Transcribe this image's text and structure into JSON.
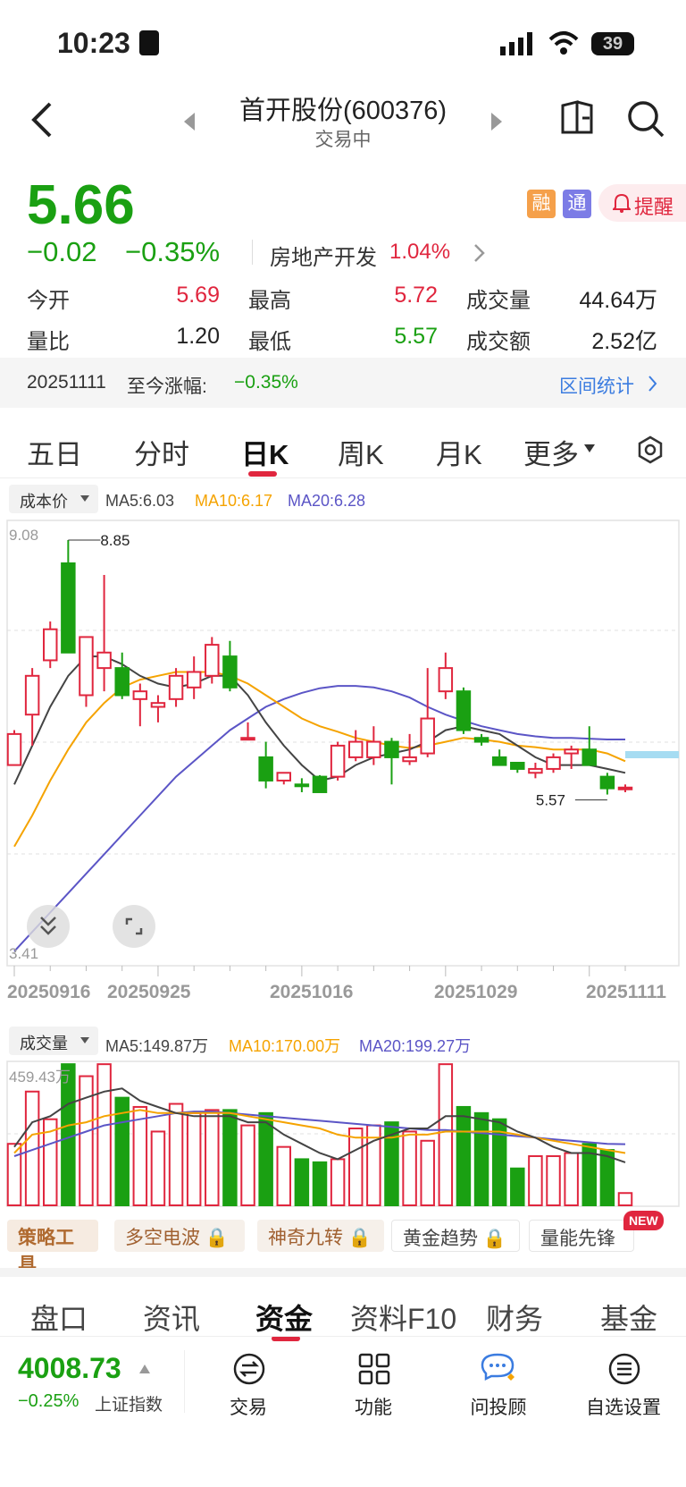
{
  "status": {
    "time": "10:23",
    "battery": "39"
  },
  "header": {
    "title": "首开股份(600376)",
    "subtitle": "交易中"
  },
  "quote": {
    "price": "5.66",
    "change": "−0.02",
    "change_pct": "−0.35%",
    "sector_name": "房地产开发",
    "sector_pct": "1.04%",
    "badge_rong": "融",
    "badge_tong": "通",
    "alert_label": "提醒",
    "stats": [
      {
        "label": "今开",
        "value": "5.69"
      },
      {
        "label": "最高",
        "value": "5.72"
      },
      {
        "label": "成交量",
        "value": "44.64万"
      },
      {
        "label": "量比",
        "value": "1.20"
      },
      {
        "label": "最低",
        "value": "5.57"
      },
      {
        "label": "成交额",
        "value": "2.52亿"
      }
    ]
  },
  "range_bar": {
    "date": "20251111",
    "label": "至今涨幅:",
    "value": "−0.35%",
    "link": "区间统计"
  },
  "chart_tabs": [
    "五日",
    "分时",
    "日K",
    "周K",
    "月K",
    "更多"
  ],
  "kline_legend": {
    "cost": "成本价",
    "ma5": "MA5:6.03",
    "ma10": "MA10:6.17",
    "ma20": "MA20:6.28"
  },
  "volume_legend": {
    "label": "成交量",
    "ma5": "MA5:149.87万",
    "ma10": "MA10:170.00万",
    "ma20": "MA20:199.27万",
    "max": "459.43万"
  },
  "colors": {
    "up": "#e0263e",
    "down": "#1aa012",
    "ma5": "#444444",
    "ma10": "#f5a300",
    "ma20": "#5b55c6"
  },
  "chart_data": {
    "type": "candlestick",
    "ylim": [
      3.41,
      9.08
    ],
    "y_top_label": "9.08",
    "y_bottom_label": "3.41",
    "high_label": "8.85",
    "low_label": "5.57",
    "x_ticks": [
      "20250916",
      "20250925",
      "20251016",
      "20251029",
      "20251111"
    ],
    "candles": [
      {
        "o": 5.95,
        "c": 6.35,
        "h": 6.4,
        "l": 5.95
      },
      {
        "o": 6.6,
        "c": 7.1,
        "h": 7.2,
        "l": 6.2
      },
      {
        "o": 7.3,
        "c": 7.7,
        "h": 7.8,
        "l": 7.2
      },
      {
        "o": 8.55,
        "c": 7.4,
        "h": 8.85,
        "l": 7.4
      },
      {
        "o": 6.85,
        "c": 7.6,
        "h": 7.6,
        "l": 6.7
      },
      {
        "o": 7.2,
        "c": 7.4,
        "h": 8.4,
        "l": 6.9
      },
      {
        "o": 7.2,
        "c": 6.85,
        "h": 7.4,
        "l": 6.8
      },
      {
        "o": 6.8,
        "c": 6.9,
        "h": 7.0,
        "l": 6.45
      },
      {
        "o": 6.7,
        "c": 6.75,
        "h": 6.85,
        "l": 6.5
      },
      {
        "o": 6.8,
        "c": 7.1,
        "h": 7.2,
        "l": 6.7
      },
      {
        "o": 6.95,
        "c": 7.15,
        "h": 7.35,
        "l": 6.8
      },
      {
        "o": 7.1,
        "c": 7.5,
        "h": 7.6,
        "l": 7.0
      },
      {
        "o": 7.35,
        "c": 6.95,
        "h": 7.55,
        "l": 6.9
      },
      {
        "o": 6.3,
        "c": 6.3,
        "h": 6.5,
        "l": 6.3
      },
      {
        "o": 6.05,
        "c": 5.75,
        "h": 6.25,
        "l": 5.65
      },
      {
        "o": 5.75,
        "c": 5.85,
        "h": 5.85,
        "l": 5.7
      },
      {
        "o": 5.7,
        "c": 5.68,
        "h": 5.78,
        "l": 5.6
      },
      {
        "o": 5.8,
        "c": 5.6,
        "h": 5.82,
        "l": 5.6
      },
      {
        "o": 5.8,
        "c": 6.2,
        "h": 6.25,
        "l": 5.75
      },
      {
        "o": 6.05,
        "c": 6.25,
        "h": 6.4,
        "l": 6.0
      },
      {
        "o": 6.05,
        "c": 6.25,
        "h": 6.45,
        "l": 5.95
      },
      {
        "o": 6.25,
        "c": 6.05,
        "h": 6.3,
        "l": 5.7
      },
      {
        "o": 6.0,
        "c": 6.05,
        "h": 6.35,
        "l": 5.95
      },
      {
        "o": 6.1,
        "c": 6.55,
        "h": 7.2,
        "l": 6.05
      },
      {
        "o": 6.9,
        "c": 7.2,
        "h": 7.4,
        "l": 6.8
      },
      {
        "o": 6.9,
        "c": 6.4,
        "h": 6.95,
        "l": 6.35
      },
      {
        "o": 6.3,
        "c": 6.25,
        "h": 6.35,
        "l": 6.2
      },
      {
        "o": 6.05,
        "c": 5.95,
        "h": 6.15,
        "l": 5.95
      },
      {
        "o": 5.98,
        "c": 5.9,
        "h": 5.98,
        "l": 5.85
      },
      {
        "o": 5.85,
        "c": 5.9,
        "h": 5.98,
        "l": 5.78
      },
      {
        "o": 5.9,
        "c": 6.05,
        "h": 6.1,
        "l": 5.85
      },
      {
        "o": 6.1,
        "c": 6.15,
        "h": 6.2,
        "l": 5.9
      },
      {
        "o": 6.15,
        "c": 5.95,
        "h": 6.45,
        "l": 5.95
      },
      {
        "o": 5.8,
        "c": 5.65,
        "h": 5.85,
        "l": 5.57
      },
      {
        "o": 5.66,
        "c": 5.66,
        "h": 5.7,
        "l": 5.6
      }
    ],
    "ma5": [
      5.7,
      6.2,
      6.7,
      7.1,
      7.35,
      7.35,
      7.25,
      7.1,
      7.0,
      6.95,
      7.0,
      7.1,
      7.1,
      6.85,
      6.5,
      6.2,
      5.95,
      5.75,
      5.8,
      5.95,
      6.05,
      6.1,
      6.15,
      6.25,
      6.4,
      6.45,
      6.4,
      6.35,
      6.2,
      6.05,
      5.95,
      5.95,
      5.95,
      5.9,
      5.85
    ],
    "ma10": [
      4.9,
      5.3,
      5.75,
      6.15,
      6.5,
      6.75,
      6.95,
      7.05,
      7.1,
      7.15,
      7.15,
      7.15,
      7.1,
      7.0,
      6.85,
      6.7,
      6.55,
      6.45,
      6.38,
      6.3,
      6.25,
      6.2,
      6.17,
      6.2,
      6.25,
      6.3,
      6.28,
      6.25,
      6.2,
      6.18,
      6.15,
      6.15,
      6.15,
      6.1,
      6.0
    ],
    "ma20": [
      3.55,
      3.8,
      4.05,
      4.3,
      4.55,
      4.8,
      5.05,
      5.3,
      5.55,
      5.8,
      6.0,
      6.2,
      6.4,
      6.55,
      6.7,
      6.8,
      6.88,
      6.94,
      6.97,
      6.97,
      6.95,
      6.9,
      6.82,
      6.7,
      6.6,
      6.52,
      6.45,
      6.4,
      6.35,
      6.32,
      6.3,
      6.3,
      6.29,
      6.28,
      6.28
    ],
    "volume": [
      200,
      370,
      280,
      459,
      420,
      459,
      350,
      320,
      240,
      330,
      300,
      310,
      310,
      260,
      300,
      190,
      150,
      140,
      150,
      250,
      260,
      270,
      240,
      210,
      459,
      320,
      300,
      280,
      120,
      160,
      160,
      170,
      200,
      180,
      40
    ],
    "volume_ylim": [
      0,
      459.43
    ],
    "vol_ma5": [
      190,
      270,
      290,
      330,
      350,
      370,
      380,
      340,
      320,
      300,
      290,
      290,
      290,
      270,
      270,
      230,
      200,
      170,
      150,
      180,
      210,
      230,
      250,
      250,
      290,
      290,
      280,
      270,
      240,
      220,
      190,
      170,
      170,
      160,
      140
    ],
    "vol_ma10": [
      170,
      230,
      240,
      260,
      270,
      290,
      300,
      310,
      300,
      300,
      300,
      300,
      300,
      290,
      280,
      270,
      260,
      250,
      230,
      220,
      220,
      220,
      230,
      230,
      240,
      240,
      240,
      240,
      230,
      220,
      210,
      200,
      190,
      180,
      170
    ],
    "vol_ma20": [
      160,
      180,
      200,
      220,
      240,
      260,
      270,
      280,
      290,
      300,
      305,
      305,
      300,
      295,
      290,
      285,
      280,
      275,
      270,
      265,
      260,
      255,
      250,
      245,
      245,
      240,
      235,
      230,
      225,
      220,
      215,
      210,
      205,
      200,
      199
    ]
  },
  "tools": {
    "title": "策略工具",
    "items": [
      "多空电波",
      "神奇九转",
      "黄金趋势",
      "量能先锋"
    ],
    "new_badge": "NEW"
  },
  "bottom_tabs": [
    "盘口",
    "资讯",
    "资金",
    "资料F10",
    "财务",
    "基金"
  ],
  "index": {
    "value": "4008.73",
    "change": "−0.25%",
    "name": "上证指数"
  },
  "nav": [
    "交易",
    "功能",
    "问投顾",
    "自选设置"
  ]
}
